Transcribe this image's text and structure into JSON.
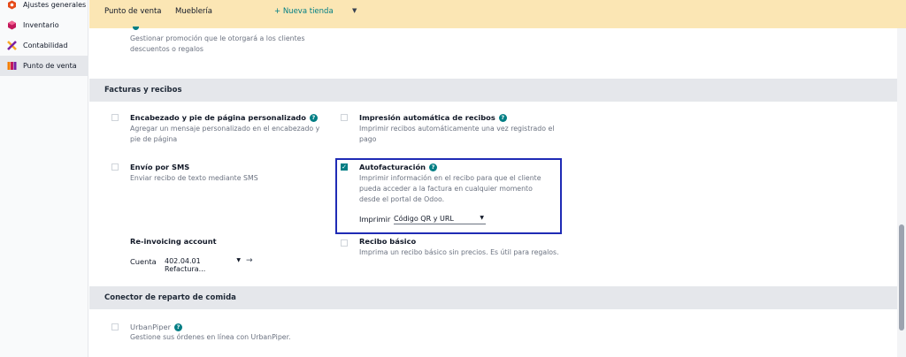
{
  "sidebar": {
    "items": [
      {
        "label": "Ajustes generales",
        "icon": "settings-hex-icon",
        "color": "#e64a19"
      },
      {
        "label": "Inventario",
        "icon": "inventory-box-icon",
        "color": "#c2185b"
      },
      {
        "label": "Contabilidad",
        "icon": "accounting-x-icon",
        "color": "#f9a825"
      },
      {
        "label": "Punto de venta",
        "icon": "pos-store-icon",
        "color": "#f57c00"
      }
    ]
  },
  "topbar": {
    "title": "Punto de venta",
    "store_value": "Mueblería",
    "new_store": "+ Nueva tienda",
    "bg_color": "#fbe6b4"
  },
  "promo": {
    "description": "Gestionar promoción que le otorgará a los clientes descuentos o regalos"
  },
  "sections": {
    "invoices": {
      "title": "Facturas y recibos",
      "settings": {
        "header_footer": {
          "label": "Encabezado y pie de página personalizado",
          "description": "Agregar un mensaje personalizado en el encabezado y pie de página",
          "checked": false
        },
        "auto_print": {
          "label": "Impresión automática de recibos",
          "description": "Imprimir recibos automáticamente una vez registrado el pago",
          "checked": false
        },
        "sms": {
          "label": "Envío por SMS",
          "description": "Enviar recibo de texto mediante SMS",
          "checked": false
        },
        "self_invoice": {
          "label": "Autofacturación",
          "description": "Imprimir información en el recibo para que el cliente pueda acceder a la factura en cualquier momento desde el portal de Odoo.",
          "checked": true,
          "print_label": "Imprimir",
          "print_value": "Código QR y URL"
        },
        "reinvoicing": {
          "label": "Re-invoicing account",
          "account_label": "Cuenta",
          "account_value": "402.04.01 Refactura..."
        },
        "basic_receipt": {
          "label": "Recibo básico",
          "description": "Imprima un recibo básico sin precios. Es útil para regalos.",
          "checked": false
        }
      }
    },
    "food_delivery": {
      "title": "Conector de reparto de comida",
      "settings": {
        "urbanpiper": {
          "label": "UrbanPiper",
          "description": "Gestione sus órdenes en línea con UrbanPiper.",
          "checked": false
        }
      }
    }
  },
  "accent_color": "#017e84",
  "highlight_color": "#1f2bb5"
}
